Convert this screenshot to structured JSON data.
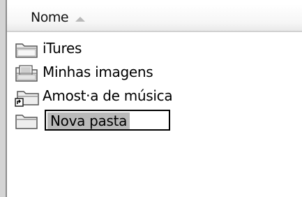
{
  "header": {
    "name_column": "Nome",
    "sort_icon": "sort-ascending-arrow"
  },
  "items": [
    {
      "label": "iTures",
      "icon": "folder-icon"
    },
    {
      "label": "Minhas imagens",
      "icon": "pictures-folder-icon"
    },
    {
      "label": "Amost·a de música",
      "icon": "music-folder-shortcut-icon"
    }
  ],
  "rename": {
    "value": "Nova pasta",
    "icon": "new-folder-icon"
  }
}
